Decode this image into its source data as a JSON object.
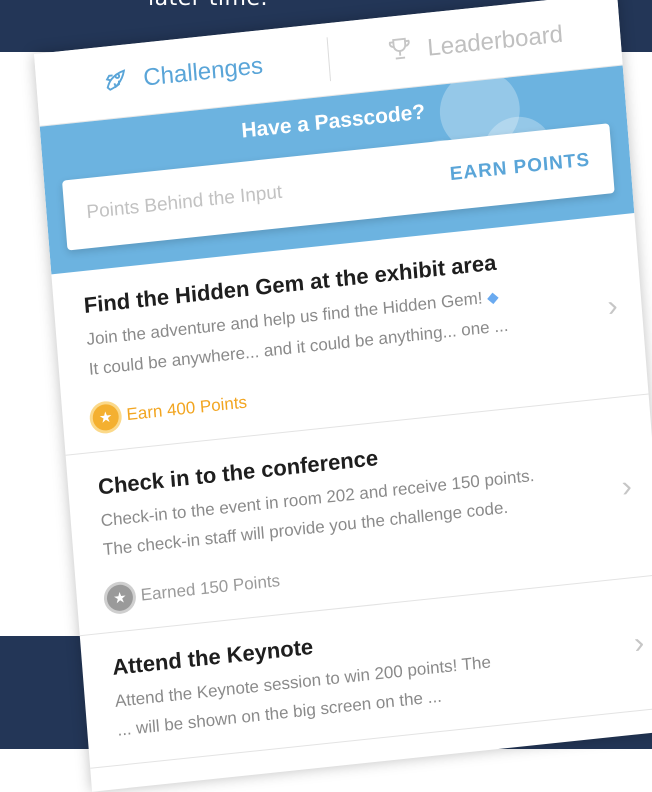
{
  "banner_top": {
    "text": "later time."
  },
  "tabs": [
    {
      "label": "Challenges",
      "icon": "rocket-icon",
      "active": true
    },
    {
      "label": "Leaderboard",
      "icon": "trophy-icon",
      "active": false
    }
  ],
  "passcode": {
    "title": "Have a Passcode?",
    "input_placeholder": "Points Behind the Input",
    "input_value": "",
    "button_label": "EARN POINTS"
  },
  "challenges": [
    {
      "title": "Find the Hidden Gem at the exhibit area",
      "desc_line1": "Join the adventure and help us find the Hidden Gem!",
      "desc_icon": "diamond-icon",
      "desc_line2": "It could be anywhere... and it could be anything... one ...",
      "points_label": "Earn 400 Points",
      "status": "earn"
    },
    {
      "title": "Check in to the conference",
      "desc_line1": "Check-in to the event in room 202 and receive 150 points.",
      "desc_line2": "The check-in staff will provide you the challenge code.",
      "points_label": "Earned 150 Points",
      "status": "earned"
    },
    {
      "title": "Attend the Keynote",
      "desc_line1": "Attend the Keynote session to win 200 points! The",
      "desc_line2": "... will be shown on the big screen on the ..."
    }
  ],
  "colors": {
    "navy_background": "#233657",
    "accent_blue": "#5aa5d8",
    "banner_blue": "#6cb3e0",
    "earn_gold": "#f2a520",
    "earned_gray": "#9a9a9a"
  }
}
